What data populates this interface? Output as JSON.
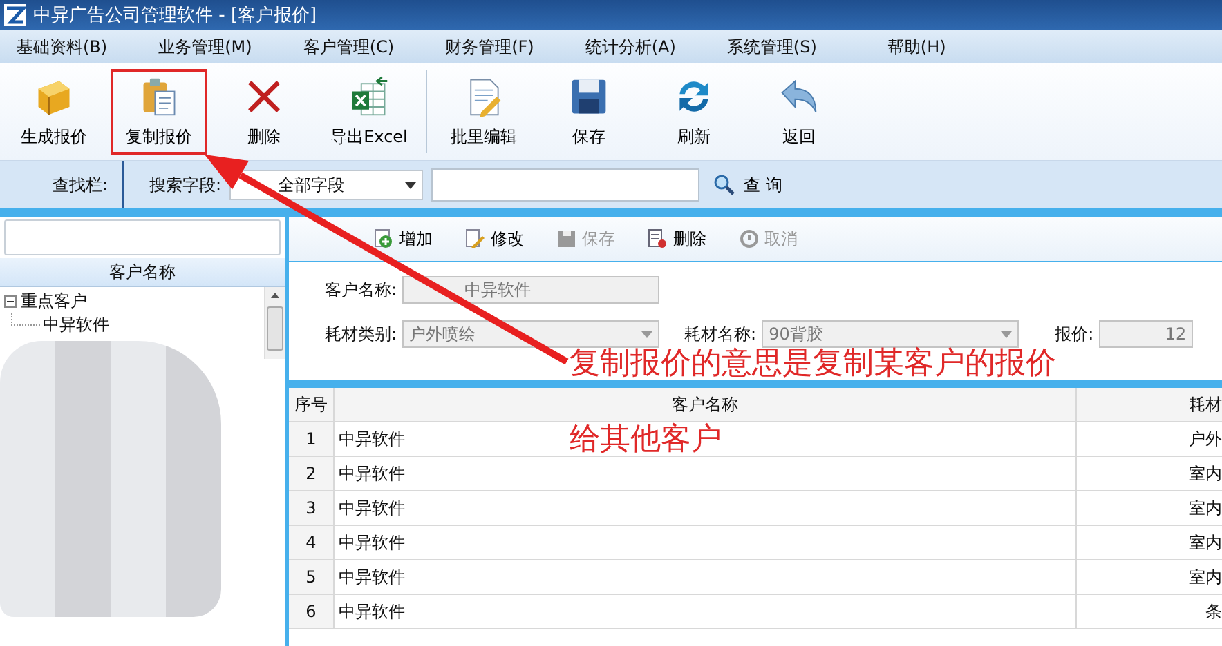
{
  "window": {
    "title": "中异广告公司管理软件 - [客户报价]"
  },
  "menu": [
    "基础资料(B)",
    "业务管理(M)",
    "客户管理(C)",
    "财务管理(F)",
    "统计分析(A)",
    "系统管理(S)",
    "帮助(H)"
  ],
  "toolbar": [
    {
      "label": "生成报价",
      "highlighted": false
    },
    {
      "label": "复制报价",
      "highlighted": true
    },
    {
      "label": "删除",
      "highlighted": false
    },
    {
      "label": "导出Excel",
      "highlighted": false
    },
    {
      "label": "批里编辑",
      "highlighted": false
    },
    {
      "label": "保存",
      "highlighted": false
    },
    {
      "label": "刷新",
      "highlighted": false
    },
    {
      "label": "返回",
      "highlighted": false
    }
  ],
  "search": {
    "label": "查找栏:",
    "field_label": "搜索字段:",
    "field_value": "全部字段",
    "button": "查 询"
  },
  "tree": {
    "header": "客户名称",
    "groups": [
      {
        "label": "重点客户",
        "expanded": true,
        "children": [
          {
            "label": "中异软件"
          }
        ]
      }
    ]
  },
  "edit_toolbar": [
    {
      "label": "增加",
      "disabled": false
    },
    {
      "label": "修改",
      "disabled": false
    },
    {
      "label": "保存",
      "disabled": true
    },
    {
      "label": "删除",
      "disabled": false
    },
    {
      "label": "取消",
      "disabled": true
    }
  ],
  "form": {
    "customer_label": "客户名称:",
    "customer_value": "中异软件",
    "category_label": "耗材类别:",
    "category_value": "户外喷绘",
    "material_label": "耗材名称:",
    "material_value": "90背胶",
    "price_label": "报价:",
    "price_value": "12"
  },
  "table": {
    "columns": [
      "序号",
      "客户名称",
      "耗材"
    ],
    "rows": [
      [
        "1",
        "中异软件",
        "户外"
      ],
      [
        "2",
        "中异软件",
        "室内"
      ],
      [
        "3",
        "中异软件",
        "室内"
      ],
      [
        "4",
        "中异软件",
        "室内"
      ],
      [
        "5",
        "中异软件",
        "室内"
      ],
      [
        "6",
        "中异软件",
        "条"
      ]
    ]
  },
  "annotation": {
    "lines": [
      "复制报价的意思是复制某客户的报价",
      "给其他客户"
    ]
  }
}
